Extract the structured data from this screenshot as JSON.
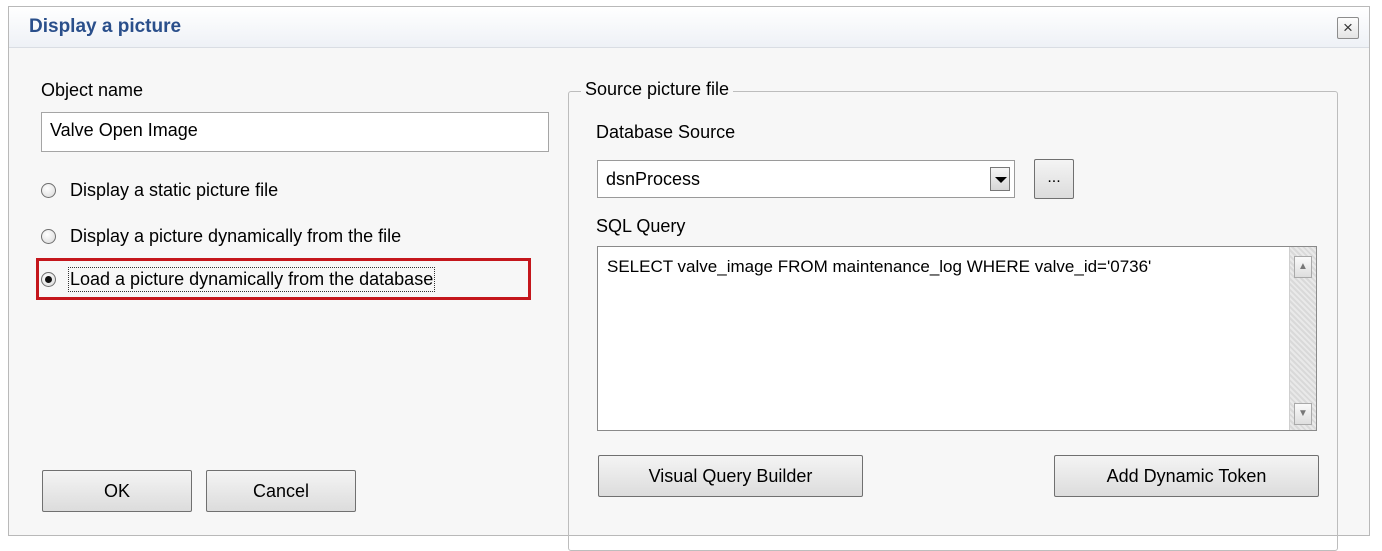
{
  "dialog": {
    "title": "Display a picture",
    "close_glyph": "×"
  },
  "left": {
    "object_name_label": "Object name",
    "object_name_value": "Valve Open Image",
    "options": [
      {
        "label": "Display a static picture file",
        "checked": false
      },
      {
        "label": "Display a picture dynamically from the file",
        "checked": false
      },
      {
        "label": "Load a picture dynamically from the database",
        "checked": true
      }
    ],
    "ok_label": "OK",
    "cancel_label": "Cancel"
  },
  "source": {
    "legend": "Source picture file",
    "db_label": "Database Source",
    "db_value": "dsnProcess",
    "browse_label": "...",
    "sql_label": "SQL Query",
    "sql_value": "SELECT valve_image FROM maintenance_log WHERE valve_id='0736'",
    "scroll_up_glyph": "▲",
    "scroll_down_glyph": "▼",
    "vqb_label": "Visual Query Builder",
    "token_label": "Add Dynamic Token"
  },
  "colors": {
    "title": "#2a4f8b",
    "highlight": "#c4161c",
    "dialog_bg": "#f7f7f7"
  }
}
